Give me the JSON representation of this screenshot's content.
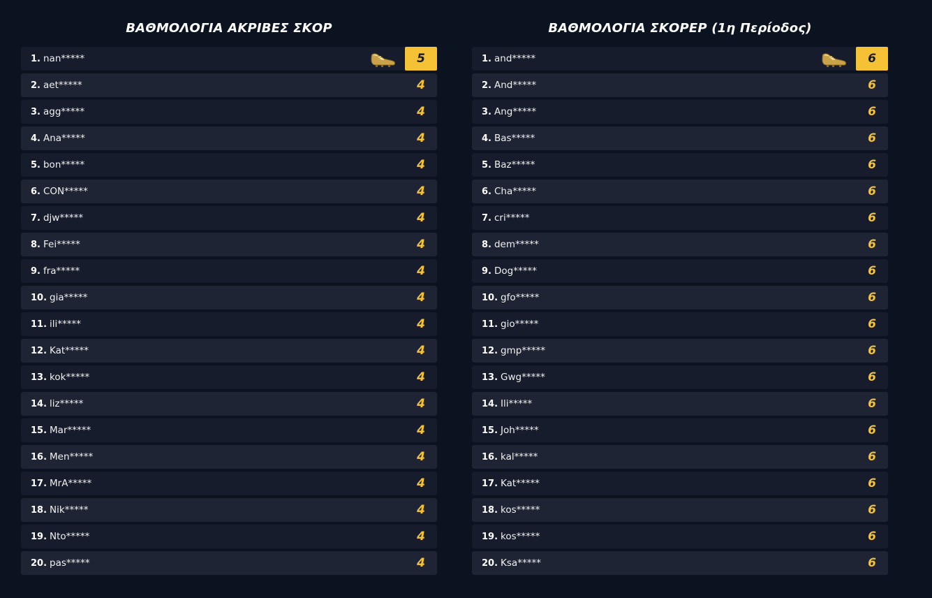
{
  "colors": {
    "background": "#0b1220",
    "row_dark": "#161c2c",
    "row_light": "#1e2434",
    "accent": "#f4c234"
  },
  "leader_icon": "golden-boot-icon",
  "boards": [
    {
      "title": "ΒΑΘΜΟΛΟΓΙΑ ΑΚΡΙΒΕΣ ΣΚΟΡ",
      "rows": [
        {
          "rank": "1.",
          "name": "nan*****",
          "points": "5"
        },
        {
          "rank": "2.",
          "name": "aet*****",
          "points": "4"
        },
        {
          "rank": "3.",
          "name": "agg*****",
          "points": "4"
        },
        {
          "rank": "4.",
          "name": "Ana*****",
          "points": "4"
        },
        {
          "rank": "5.",
          "name": "bon*****",
          "points": "4"
        },
        {
          "rank": "6.",
          "name": "CON*****",
          "points": "4"
        },
        {
          "rank": "7.",
          "name": "djw*****",
          "points": "4"
        },
        {
          "rank": "8.",
          "name": "Fei*****",
          "points": "4"
        },
        {
          "rank": "9.",
          "name": "fra*****",
          "points": "4"
        },
        {
          "rank": "10.",
          "name": "gia*****",
          "points": "4"
        },
        {
          "rank": "11.",
          "name": "ili*****",
          "points": "4"
        },
        {
          "rank": "12.",
          "name": "Kat*****",
          "points": "4"
        },
        {
          "rank": "13.",
          "name": "kok*****",
          "points": "4"
        },
        {
          "rank": "14.",
          "name": "liz*****",
          "points": "4"
        },
        {
          "rank": "15.",
          "name": "Mar*****",
          "points": "4"
        },
        {
          "rank": "16.",
          "name": "Men*****",
          "points": "4"
        },
        {
          "rank": "17.",
          "name": "MrA*****",
          "points": "4"
        },
        {
          "rank": "18.",
          "name": "Nik*****",
          "points": "4"
        },
        {
          "rank": "19.",
          "name": "Nto*****",
          "points": "4"
        },
        {
          "rank": "20.",
          "name": "pas*****",
          "points": "4"
        }
      ]
    },
    {
      "title": "ΒΑΘΜΟΛΟΓΙΑ ΣΚΟΡΕΡ (1η Περίοδος)",
      "rows": [
        {
          "rank": "1.",
          "name": "and*****",
          "points": "6"
        },
        {
          "rank": "2.",
          "name": "And*****",
          "points": "6"
        },
        {
          "rank": "3.",
          "name": "Ang*****",
          "points": "6"
        },
        {
          "rank": "4.",
          "name": "Bas*****",
          "points": "6"
        },
        {
          "rank": "5.",
          "name": "Baz*****",
          "points": "6"
        },
        {
          "rank": "6.",
          "name": "Cha*****",
          "points": "6"
        },
        {
          "rank": "7.",
          "name": "cri*****",
          "points": "6"
        },
        {
          "rank": "8.",
          "name": "dem*****",
          "points": "6"
        },
        {
          "rank": "9.",
          "name": "Dog*****",
          "points": "6"
        },
        {
          "rank": "10.",
          "name": "gfo*****",
          "points": "6"
        },
        {
          "rank": "11.",
          "name": "gio*****",
          "points": "6"
        },
        {
          "rank": "12.",
          "name": "gmp*****",
          "points": "6"
        },
        {
          "rank": "13.",
          "name": "Gwg*****",
          "points": "6"
        },
        {
          "rank": "14.",
          "name": "Ili*****",
          "points": "6"
        },
        {
          "rank": "15.",
          "name": "Joh*****",
          "points": "6"
        },
        {
          "rank": "16.",
          "name": "kal*****",
          "points": "6"
        },
        {
          "rank": "17.",
          "name": "Kat*****",
          "points": "6"
        },
        {
          "rank": "18.",
          "name": "kos*****",
          "points": "6"
        },
        {
          "rank": "19.",
          "name": "kos*****",
          "points": "6"
        },
        {
          "rank": "20.",
          "name": "Ksa*****",
          "points": "6"
        }
      ]
    }
  ]
}
